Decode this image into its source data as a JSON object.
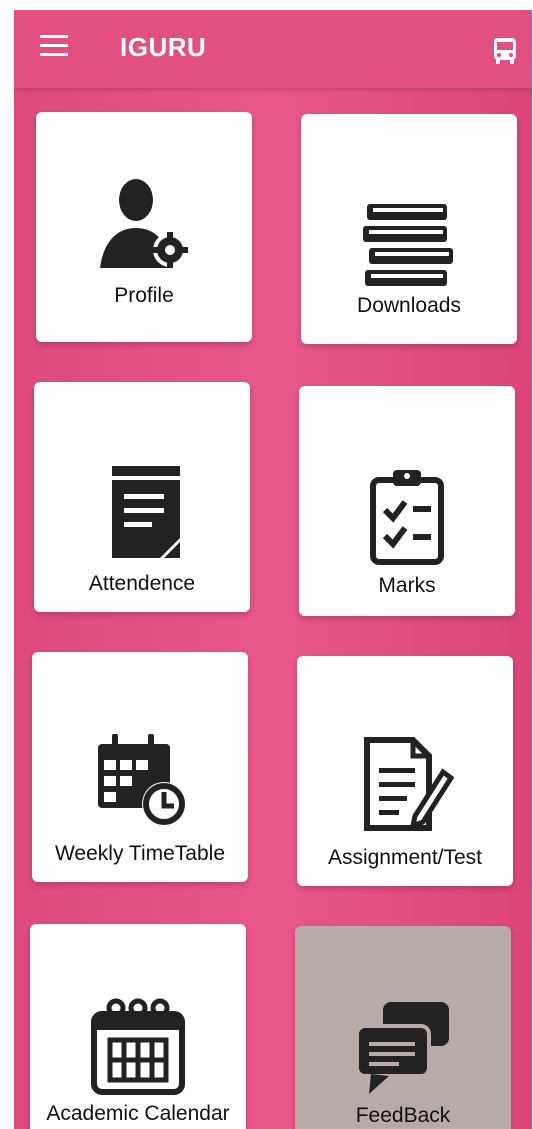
{
  "app": {
    "title": "IGURU",
    "menu_icon": "menu-icon",
    "action_icon": "bus-icon"
  },
  "colors": {
    "appbar": "#e2507f",
    "background": "#e0517f",
    "tile": "#ffffff",
    "tile_feedback": "#b8aaa6",
    "icon": "#222222"
  },
  "tiles": [
    {
      "label": "Profile",
      "icon": "profile-settings-icon"
    },
    {
      "label": "Downloads",
      "icon": "books-icon"
    },
    {
      "label": "Attendence",
      "icon": "notepad-icon"
    },
    {
      "label": "Marks",
      "icon": "checklist-clipboard-icon"
    },
    {
      "label": "Weekly TimeTable",
      "icon": "calendar-clock-icon"
    },
    {
      "label": "Assignment/Test",
      "icon": "document-pen-icon"
    },
    {
      "label": "Academic Calendar",
      "icon": "calendar-icon"
    },
    {
      "label": "FeedBack",
      "icon": "chat-bubbles-icon"
    }
  ]
}
